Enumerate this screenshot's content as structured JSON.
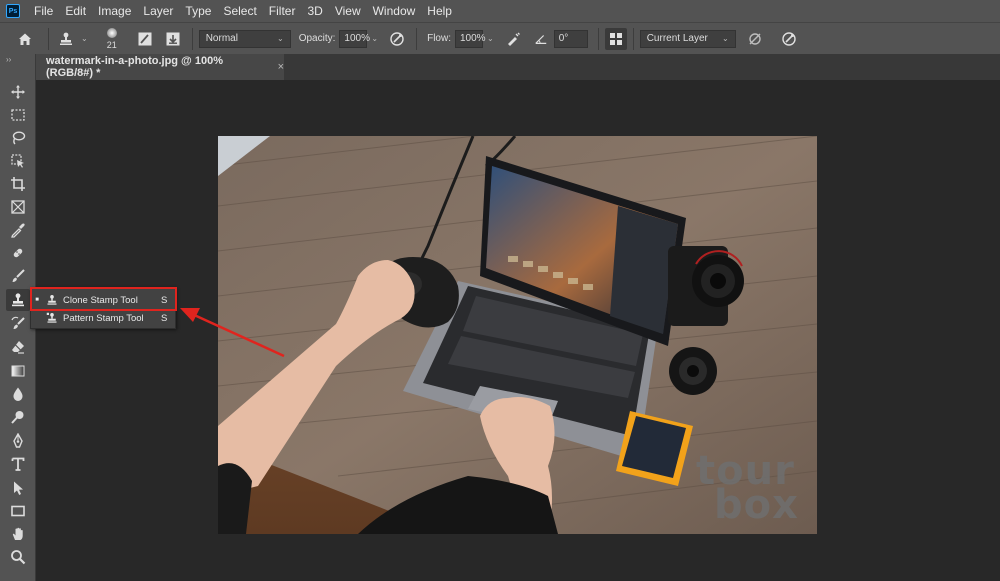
{
  "app": {
    "logo_text": "Ps"
  },
  "menu": [
    "File",
    "Edit",
    "Image",
    "Layer",
    "Type",
    "Select",
    "Filter",
    "3D",
    "View",
    "Window",
    "Help"
  ],
  "options": {
    "brush_size": "21",
    "mode": "Normal",
    "opacity_label": "Opacity:",
    "opacity": "100%",
    "flow_label": "Flow:",
    "flow": "100%",
    "angle": "0°",
    "sample": "Current Layer"
  },
  "document_tab": {
    "title": "watermark-in-a-photo.jpg @ 100% (RGB/8#) *",
    "close": "×"
  },
  "toolbar": {
    "collapse": "››"
  },
  "flyout": {
    "items": [
      {
        "bullet": "■",
        "label": "Clone Stamp Tool",
        "key": "S"
      },
      {
        "bullet": "",
        "label": "Pattern Stamp Tool",
        "key": "S"
      }
    ]
  },
  "canvas": {
    "watermark_line1": "tour",
    "watermark_line2": "box"
  },
  "colors": {
    "highlight": "#e0241e",
    "panel": "#535353",
    "workspace": "#282828"
  }
}
